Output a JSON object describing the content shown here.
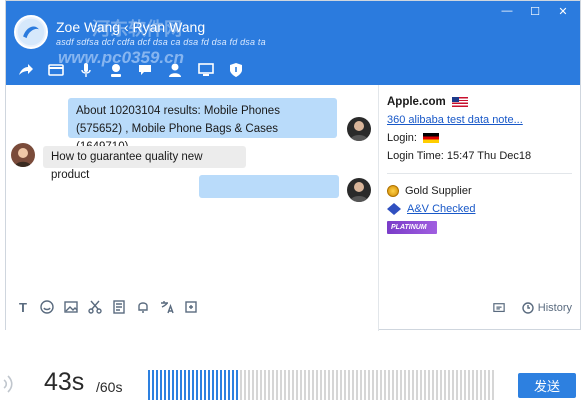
{
  "title_bar": {
    "contact_names": "Zoe Wang ‹ Ryan Wang",
    "status_text": "asdf sdfsa dcf cdfa dcf dsa ca dsa fd dsa fd dsa ta",
    "watermark_site": "河东软件网",
    "watermark_url": "www.pc0359.cn",
    "accent_color": "#2b7bde"
  },
  "window_controls": {
    "minimize": "—",
    "maximize": "☐",
    "close": "✕"
  },
  "title_toolbar": {
    "icons": [
      "forward-icon",
      "transfer-icon",
      "microphone-icon",
      "contacts-icon",
      "chat-icon",
      "profile-icon",
      "screen-icon",
      "shield-icon"
    ]
  },
  "messages": [
    {
      "side": "right",
      "text": "About 10203104 results: Mobile Phones (575652) , Mobile Phone Bags & Cases (1649710)."
    },
    {
      "side": "left",
      "text": "How to guarantee quality new product"
    },
    {
      "side": "right",
      "text": ""
    }
  ],
  "input_toolbar": {
    "icons": [
      "text-icon",
      "emoji-icon",
      "image-icon",
      "scissors-icon",
      "document-icon",
      "bell-icon",
      "translate-icon",
      "screenshot-icon",
      "shortcut-icon"
    ],
    "history_label": "History"
  },
  "right_panel": {
    "company": "Apple.com",
    "link": "360 alibaba test data note...",
    "login_label": "Login:",
    "login_time": "Login Time: 15:47 Thu Dec18",
    "gold_supplier": "Gold Supplier",
    "av_checked": "A&V Checked",
    "platinum": "PLATINUM"
  },
  "voice_bar": {
    "elapsed": "43s",
    "total": "/60s",
    "progress": 0.26,
    "send_label": "发送"
  }
}
